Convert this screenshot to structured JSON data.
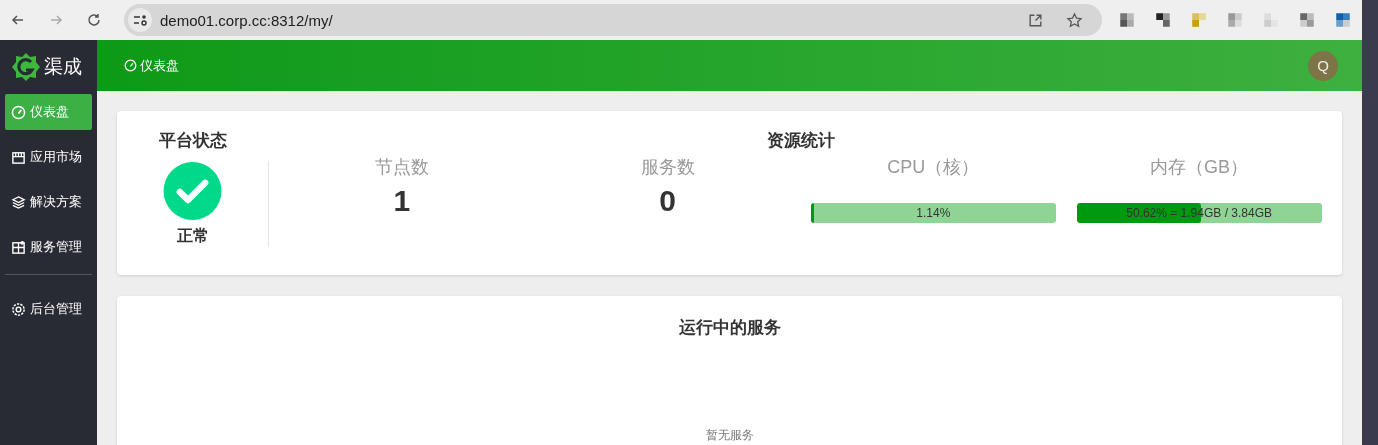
{
  "browser": {
    "url": "demo01.corp.cc:8312/my/"
  },
  "sidebar": {
    "logo": "渠成",
    "groups": [
      [
        {
          "label": "仪表盘",
          "selected": true
        },
        {
          "label": "应用市场",
          "selected": false
        },
        {
          "label": "解决方案",
          "selected": false
        },
        {
          "label": "服务管理",
          "selected": false
        }
      ],
      [
        {
          "label": "后台管理",
          "selected": false
        }
      ]
    ]
  },
  "header": {
    "breadcrumb": "仪表盘",
    "avatar": "Q"
  },
  "platform": {
    "title": "平台状态",
    "healthy": true,
    "status": "正常"
  },
  "resources": {
    "title": "资源统计",
    "stats": [
      {
        "label": "节点数",
        "value": "1"
      },
      {
        "label": "服务数",
        "value": "0"
      }
    ],
    "meters": [
      {
        "label": "CPU（核）",
        "level": 0.0114,
        "reading": "1.14%"
      },
      {
        "label": "内存（GB）",
        "level": 0.5062,
        "reading": "50.62% = 1.94GB / 3.84GB"
      }
    ]
  },
  "services": {
    "title": "运行中的服务",
    "empty": "暂无服务"
  }
}
